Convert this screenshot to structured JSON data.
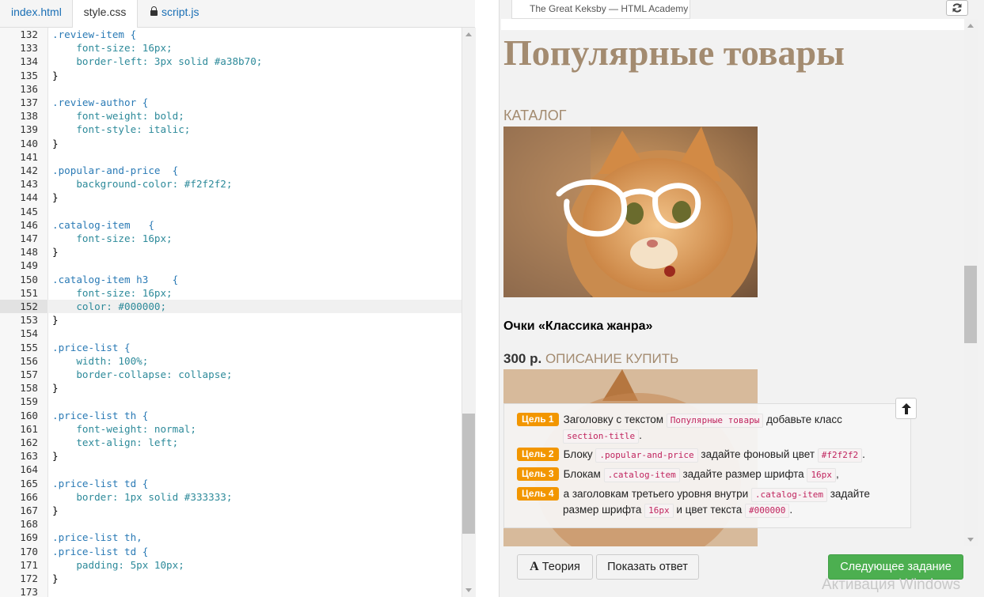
{
  "editor": {
    "tabs": [
      {
        "label": "index.html"
      },
      {
        "label": "style.css"
      },
      {
        "label": "script.js"
      }
    ],
    "lines": [
      {
        "n": "132"
      },
      {
        "n": "133"
      },
      {
        "n": "134"
      },
      {
        "n": "135"
      },
      {
        "n": "136"
      },
      {
        "n": "137"
      },
      {
        "n": "138"
      },
      {
        "n": "139"
      },
      {
        "n": "140"
      },
      {
        "n": "141"
      },
      {
        "n": "142"
      },
      {
        "n": "143"
      },
      {
        "n": "144"
      },
      {
        "n": "145"
      },
      {
        "n": "146"
      },
      {
        "n": "147"
      },
      {
        "n": "148"
      },
      {
        "n": "149"
      },
      {
        "n": "150"
      },
      {
        "n": "151"
      },
      {
        "n": "152"
      },
      {
        "n": "153"
      },
      {
        "n": "154"
      },
      {
        "n": "155"
      },
      {
        "n": "156"
      },
      {
        "n": "157"
      },
      {
        "n": "158"
      },
      {
        "n": "159"
      },
      {
        "n": "160"
      },
      {
        "n": "161"
      },
      {
        "n": "162"
      },
      {
        "n": "163"
      },
      {
        "n": "164"
      },
      {
        "n": "165"
      },
      {
        "n": "166"
      },
      {
        "n": "167"
      },
      {
        "n": "168"
      },
      {
        "n": "169"
      },
      {
        "n": "170"
      },
      {
        "n": "171"
      },
      {
        "n": "172"
      },
      {
        "n": "173"
      }
    ],
    "code": {
      "l132": ".review-item {",
      "l133": "    font-size: 16px;",
      "l134": "    border-left: 3px solid #a38b70;",
      "l135": "}",
      "l137": ".review-author {",
      "l138": "    font-weight: bold;",
      "l139": "    font-style: italic;",
      "l140": "}",
      "l142": ".popular-and-price  {",
      "l143": "    background-color: #f2f2f2;",
      "l144": "}",
      "l146": ".catalog-item   {",
      "l147": "    font-size: 16px;",
      "l148": "}",
      "l150": ".catalog-item h3    {",
      "l151": "    font-size: 16px;",
      "l152": "    color: #000000;",
      "l153": "}",
      "l155": ".price-list {",
      "l156": "    width: 100%;",
      "l157": "    border-collapse: collapse;",
      "l158": "}",
      "l160": ".price-list th {",
      "l161": "    font-weight: normal;",
      "l162": "    text-align: left;",
      "l163": "}",
      "l165": ".price-list td {",
      "l166": "    border: 1px solid #333333;",
      "l167": "}",
      "l169": ".price-list th,",
      "l170": ".price-list td {",
      "l171": "    padding: 5px 10px;",
      "l172": "}"
    }
  },
  "preview": {
    "tab_label": "The Great Keksby — HTML Academy",
    "page_title": "Популярные товары",
    "catalog_label": "КАТАЛОГ",
    "item_title": "Очки «Классика жанра»",
    "price": "300 р.",
    "price_links": "ОПИСАНИЕ КУПИТЬ"
  },
  "tasks": [
    {
      "badge": "Цель 1",
      "parts": [
        "Заголовку с текстом ",
        "Популярные товары",
        " добавьте класс",
        "section-title",
        "."
      ]
    },
    {
      "badge": "Цель 2",
      "parts": [
        "Блоку ",
        ".popular-and-price",
        " задайте фоновый цвет ",
        "#f2f2f2",
        "."
      ]
    },
    {
      "badge": "Цель 3",
      "parts": [
        "Блокам ",
        ".catalog-item",
        " задайте размер шрифта ",
        "16px",
        ","
      ]
    },
    {
      "badge": "Цель 4",
      "parts": [
        "а заголовкам третьего уровня внутри ",
        ".catalog-item",
        " задайте",
        "размер шрифта ",
        "16px",
        " и цвет текста ",
        "#000000",
        "."
      ]
    }
  ],
  "buttons": {
    "theory_icon": "А",
    "theory": "Теория",
    "show_answer": "Показать ответ",
    "next_task": "Следующее задание"
  },
  "watermark": "Активация Windows",
  "colors": {
    "accent": "#a38b70",
    "badge": "#f29600",
    "green_button": "#4caf50",
    "preview_bg": "#f2f2f2"
  }
}
